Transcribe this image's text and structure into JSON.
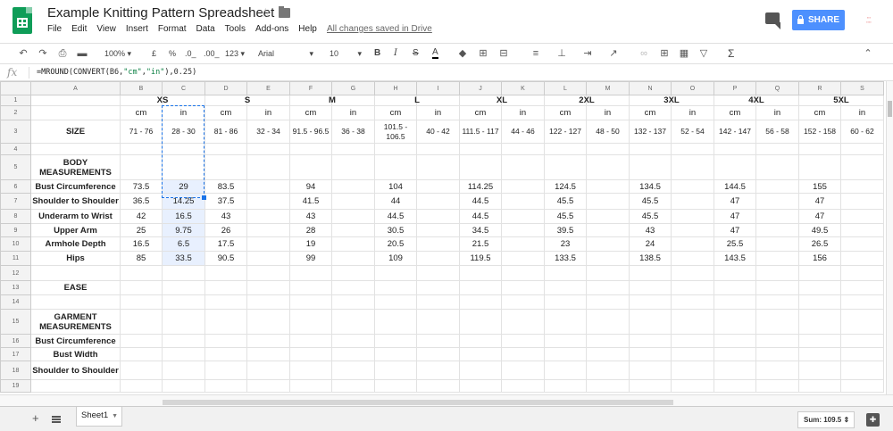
{
  "doc": {
    "title": "Example Knitting Pattern Spreadsheet",
    "save_status": "All changes saved in Drive",
    "share_label": "SHARE"
  },
  "menu": [
    "File",
    "Edit",
    "View",
    "Insert",
    "Format",
    "Data",
    "Tools",
    "Add-ons",
    "Help"
  ],
  "toolbar": {
    "zoom": "100%",
    "currency": "£",
    "percent": "%",
    "dec_less": ".0_",
    "dec_more": ".00_",
    "format_more": "123",
    "font": "Arial",
    "font_size": "10",
    "bold": "B",
    "italic": "I",
    "strike": "S",
    "text_color": "A",
    "sum": "Σ"
  },
  "formula": {
    "prefix": "=MROUND(CONVERT(",
    "cell_ref": "B6",
    "sep1": ",",
    "from": "\"cm\"",
    "sep2": ",",
    "to": "\"in\"",
    "close": "),",
    "multiple": "0.25",
    "end": ")"
  },
  "columns": [
    "A",
    "B",
    "C",
    "D",
    "E",
    "F",
    "G",
    "H",
    "I",
    "J",
    "K",
    "L",
    "M",
    "N",
    "O",
    "P",
    "Q",
    "R",
    "S"
  ],
  "rows": [
    [
      "",
      "XS",
      "",
      "S",
      "",
      "M",
      "",
      "L",
      "",
      "XL",
      "",
      "2XL",
      "",
      "3XL",
      "",
      "4XL",
      "",
      "5XL",
      ""
    ],
    [
      "",
      "cm",
      "in",
      "cm",
      "in",
      "cm",
      "in",
      "cm",
      "in",
      "cm",
      "in",
      "cm",
      "in",
      "cm",
      "in",
      "cm",
      "in",
      "cm",
      "in"
    ],
    [
      "SIZE",
      "71 - 76",
      "28 - 30",
      "81 - 86",
      "32 - 34",
      "91.5 - 96.5",
      "36 - 38",
      "101.5 - 106.5",
      "40 - 42",
      "111.5 - 117",
      "44 - 46",
      "122 - 127",
      "48 - 50",
      "132 - 137",
      "52 - 54",
      "142 - 147",
      "56 - 58",
      "152 - 158",
      "60 - 62"
    ],
    [
      "",
      "",
      "",
      "",
      "",
      "",
      "",
      "",
      "",
      "",
      "",
      "",
      "",
      "",
      "",
      "",
      "",
      "",
      ""
    ],
    [
      "BODY MEASUREMENTS",
      "",
      "",
      "",
      "",
      "",
      "",
      "",
      "",
      "",
      "",
      "",
      "",
      "",
      "",
      "",
      "",
      "",
      ""
    ],
    [
      "Bust Circumference",
      "73.5",
      "29",
      "83.5",
      "",
      "94",
      "",
      "104",
      "",
      "114.25",
      "",
      "124.5",
      "",
      "134.5",
      "",
      "144.5",
      "",
      "155",
      ""
    ],
    [
      "Shoulder to Shoulder",
      "36.5",
      "14.25",
      "37.5",
      "",
      "41.5",
      "",
      "44",
      "",
      "44.5",
      "",
      "45.5",
      "",
      "45.5",
      "",
      "47",
      "",
      "47",
      ""
    ],
    [
      "Underarm to Wrist",
      "42",
      "16.5",
      "43",
      "",
      "43",
      "",
      "44.5",
      "",
      "44.5",
      "",
      "45.5",
      "",
      "45.5",
      "",
      "47",
      "",
      "47",
      ""
    ],
    [
      "Upper Arm",
      "25",
      "9.75",
      "26",
      "",
      "28",
      "",
      "30.5",
      "",
      "34.5",
      "",
      "39.5",
      "",
      "43",
      "",
      "47",
      "",
      "49.5",
      ""
    ],
    [
      "Armhole Depth",
      "16.5",
      "6.5",
      "17.5",
      "",
      "19",
      "",
      "20.5",
      "",
      "21.5",
      "",
      "23",
      "",
      "24",
      "",
      "25.5",
      "",
      "26.5",
      ""
    ],
    [
      "Hips",
      "85",
      "33.5",
      "90.5",
      "",
      "99",
      "",
      "109",
      "",
      "119.5",
      "",
      "133.5",
      "",
      "138.5",
      "",
      "143.5",
      "",
      "156",
      ""
    ],
    [
      "",
      "",
      "",
      "",
      "",
      "",
      "",
      "",
      "",
      "",
      "",
      "",
      "",
      "",
      "",
      "",
      "",
      "",
      ""
    ],
    [
      "EASE",
      "",
      "",
      "",
      "",
      "",
      "",
      "",
      "",
      "",
      "",
      "",
      "",
      "",
      "",
      "",
      "",
      "",
      ""
    ],
    [
      "",
      "",
      "",
      "",
      "",
      "",
      "",
      "",
      "",
      "",
      "",
      "",
      "",
      "",
      "",
      "",
      "",
      "",
      ""
    ],
    [
      "GARMENT MEASUREMENTS",
      "",
      "",
      "",
      "",
      "",
      "",
      "",
      "",
      "",
      "",
      "",
      "",
      "",
      "",
      "",
      "",
      "",
      ""
    ],
    [
      "Bust Circumference",
      "",
      "",
      "",
      "",
      "",
      "",
      "",
      "",
      "",
      "",
      "",
      "",
      "",
      "",
      "",
      "",
      "",
      ""
    ],
    [
      "Bust Width",
      "",
      "",
      "",
      "",
      "",
      "",
      "",
      "",
      "",
      "",
      "",
      "",
      "",
      "",
      "",
      "",
      "",
      ""
    ],
    [
      "Shoulder to Shoulder",
      "",
      "",
      "",
      "",
      "",
      "",
      "",
      "",
      "",
      "",
      "",
      "",
      "",
      "",
      "",
      "",
      "",
      ""
    ],
    [
      "",
      "",
      "",
      "",
      "",
      "",
      "",
      "",
      "",
      "",
      "",
      "",
      "",
      "",
      "",
      "",
      "",
      "",
      ""
    ]
  ],
  "sheet_tab": "Sheet1",
  "status": {
    "sum": "Sum: 109.5"
  }
}
